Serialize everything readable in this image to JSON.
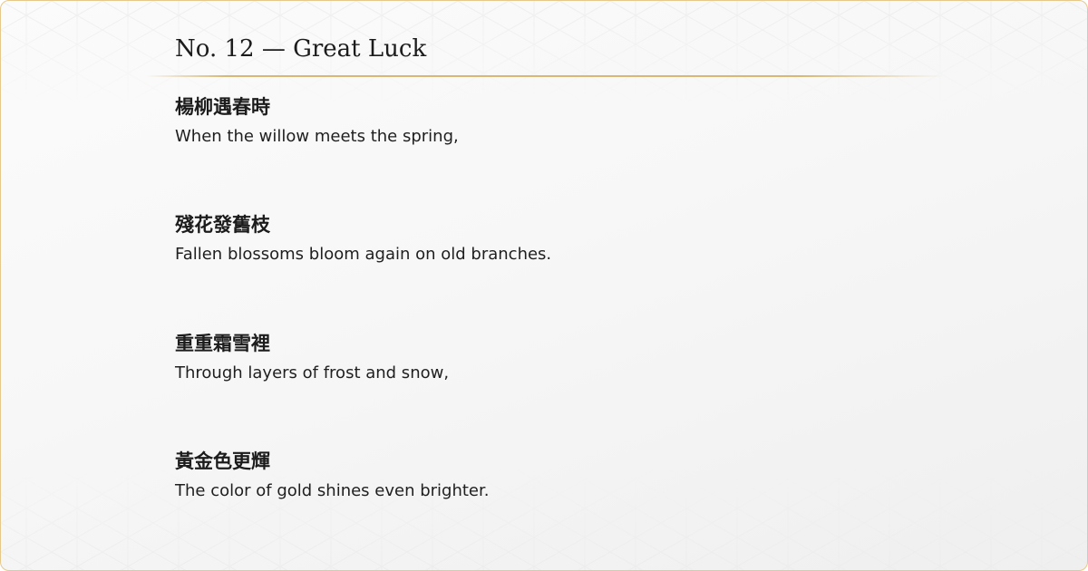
{
  "card": {
    "title": "No. 12 — Great Luck",
    "accent_color": "#d8b873",
    "verses": [
      {
        "chinese": "楊柳遇春時",
        "english": "When the willow meets the spring,"
      },
      {
        "chinese": "殘花發舊枝",
        "english": "Fallen blossoms bloom again on old branches."
      },
      {
        "chinese": "重重霜雪裡",
        "english": "Through layers of frost and snow,"
      },
      {
        "chinese": "黃金色更輝",
        "english": "The color of gold shines even brighter."
      }
    ]
  }
}
